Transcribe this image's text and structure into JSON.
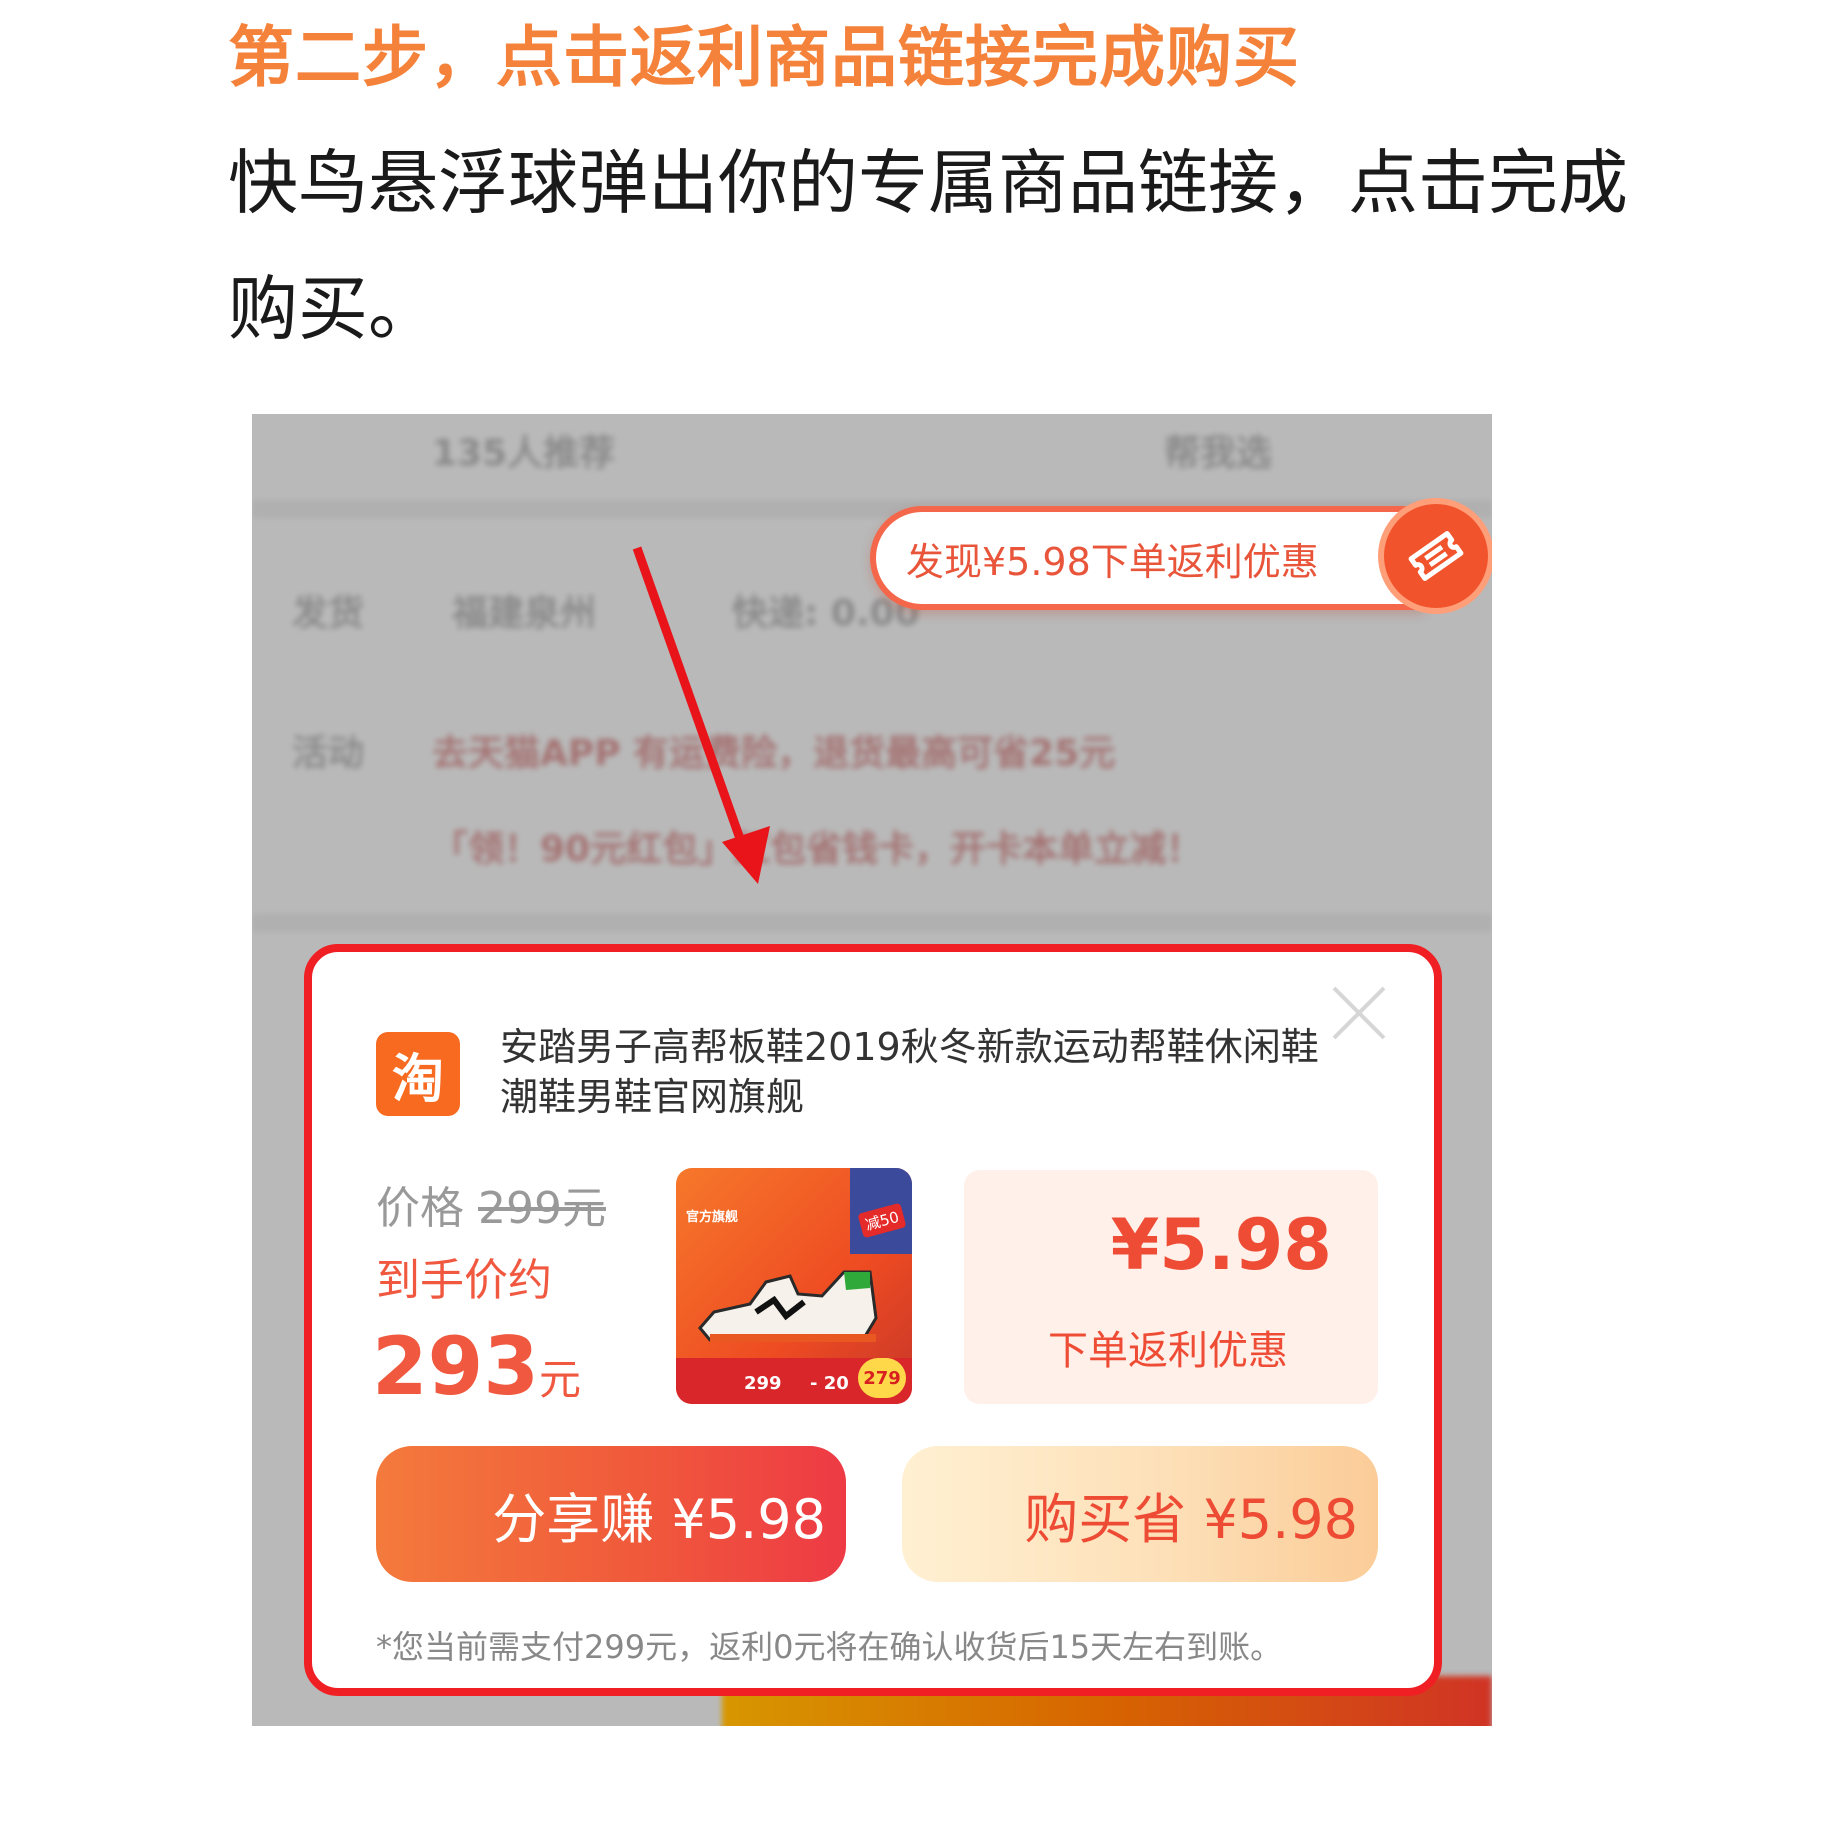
{
  "step": {
    "title": "第二步，点击返利商品链接完成购买",
    "description": "快鸟悬浮球弹出你的专属商品链接，点击完成购买。"
  },
  "background_page": {
    "recommend": "135人推荐",
    "help_select": "帮我选",
    "ship_label": "发货",
    "ship_from": "福建泉州",
    "express": "快递: 0.00",
    "promo_label": "活动",
    "promo1": "去天猫APP 有运费险，退货最高可省25元",
    "promo2": "「领！90元红包」红包省钱卡，开卡本单立减！"
  },
  "floating_ball": {
    "text": "发现¥5.98下单返利优惠",
    "icon": "ticket-icon"
  },
  "popup": {
    "platform_icon_text": "淘",
    "product_title": "安踏男子高帮板鞋2019秋冬新款运动帮鞋休闲鞋潮鞋男鞋官网旗舰",
    "price_label": "价格",
    "original_price": "299元",
    "net_price_label": "到手价约",
    "net_price": "293",
    "net_price_unit": "元",
    "image": {
      "shop_tag": "官方旗舰",
      "corner_tag": "减50",
      "price_a": "299",
      "price_b": "- 20",
      "price_c": "279"
    },
    "rebate_amount": "¥5.98",
    "rebate_label": "下单返利优惠",
    "share_button": "分享赚 ¥5.98",
    "buy_button": "购买省 ¥5.98",
    "note": "*您当前需支付299元，返利0元将在确认收货后15天左右到账。"
  },
  "colors": {
    "title_orange": "#f5823a",
    "accent_red": "#ef1f24",
    "price_red": "#f0583f"
  }
}
